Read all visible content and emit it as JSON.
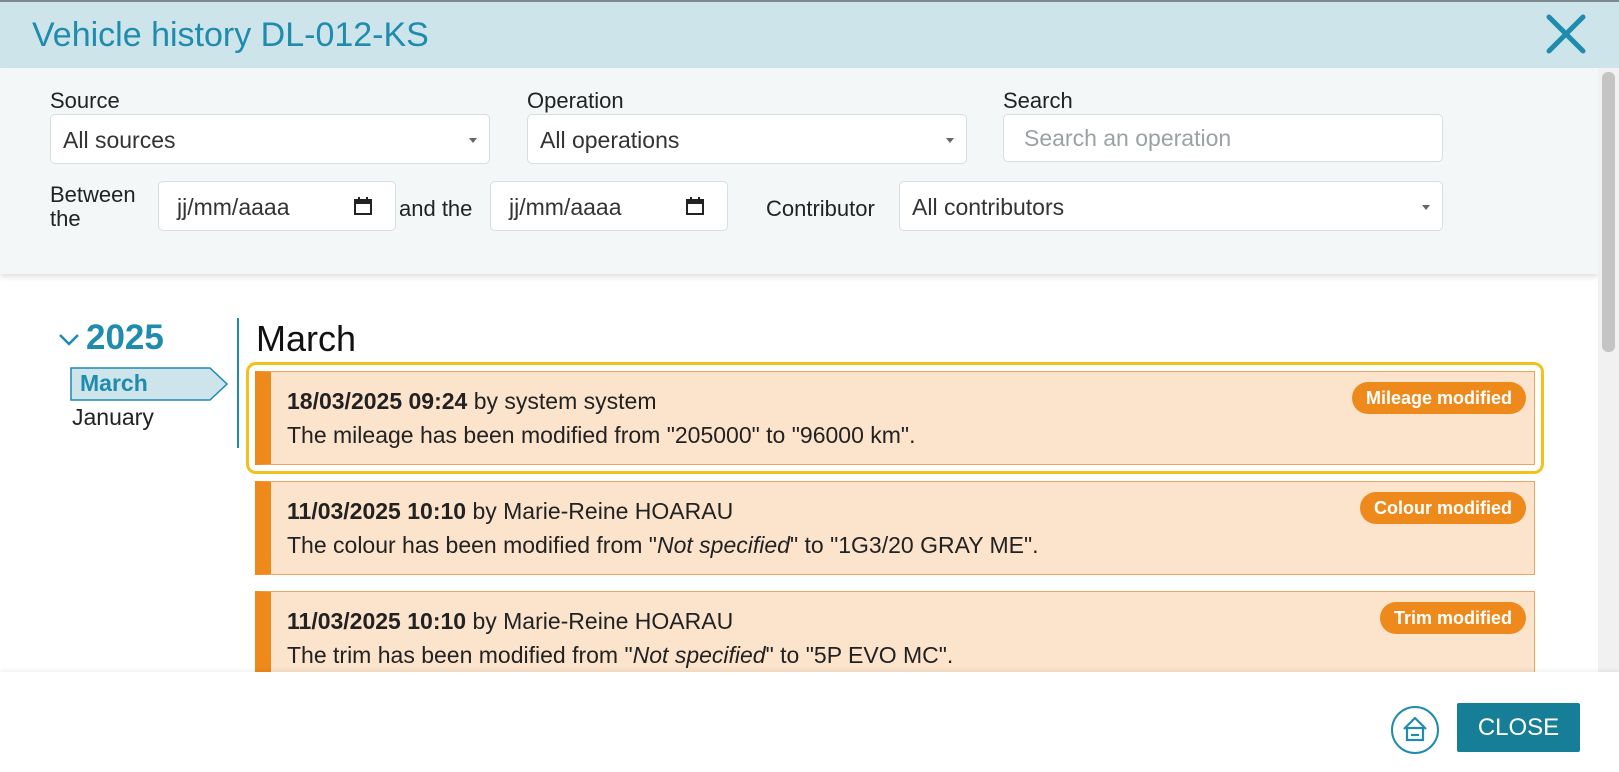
{
  "dialog": {
    "title": "Vehicle history DL-012-KS"
  },
  "filters": {
    "source": {
      "label": "Source",
      "value": "All sources"
    },
    "operation": {
      "label": "Operation",
      "value": "All operations"
    },
    "search": {
      "label": "Search",
      "placeholder": "Search an operation",
      "value": ""
    },
    "between_label_line1": "Between",
    "between_label_line2": "the",
    "date_from": {
      "placeholder": "jj/mm/aaaa"
    },
    "and_label": "and the",
    "date_to": {
      "placeholder": "jj/mm/aaaa"
    },
    "contributor": {
      "label": "Contributor",
      "value": "All contributors"
    }
  },
  "timeline_nav": {
    "year": "2025",
    "months": [
      "March",
      "January"
    ],
    "selected_month": "March"
  },
  "main": {
    "month_title": "March",
    "entries": [
      {
        "datetime": "18/03/2025 09:24",
        "by": " by system system",
        "text_before": "The mileage has been modified from \"205000\" to \"96000 km\".",
        "text_italic": "",
        "text_after": "",
        "badge": "Mileage modified",
        "focused": true
      },
      {
        "datetime": "11/03/2025 10:10",
        "by": " by Marie-Reine HOARAU",
        "text_before": "The colour has been modified from \"",
        "text_italic": "Not specified",
        "text_after": "\" to \"1G3/20 GRAY ME\".",
        "badge": "Colour modified",
        "focused": false
      },
      {
        "datetime": "11/03/2025 10:10",
        "by": " by Marie-Reine HOARAU",
        "text_before": "The trim has been modified from \"",
        "text_italic": "Not specified",
        "text_after": "\" to \"5P EVO MC\".",
        "badge": "Trim modified",
        "focused": false
      }
    ]
  },
  "footer": {
    "close_label": "CLOSE"
  },
  "icons": {
    "close": "close-x-icon",
    "home": "home-icon",
    "calendar": "calendar-icon",
    "chevron": "chevron-down-icon"
  },
  "colors": {
    "accent": "#1f8bad",
    "header_bg": "#cde5ea",
    "entry_bg": "#fbe3cc",
    "entry_accent": "#ee8a1c",
    "focus": "#f3c11a",
    "button": "#167e96"
  }
}
